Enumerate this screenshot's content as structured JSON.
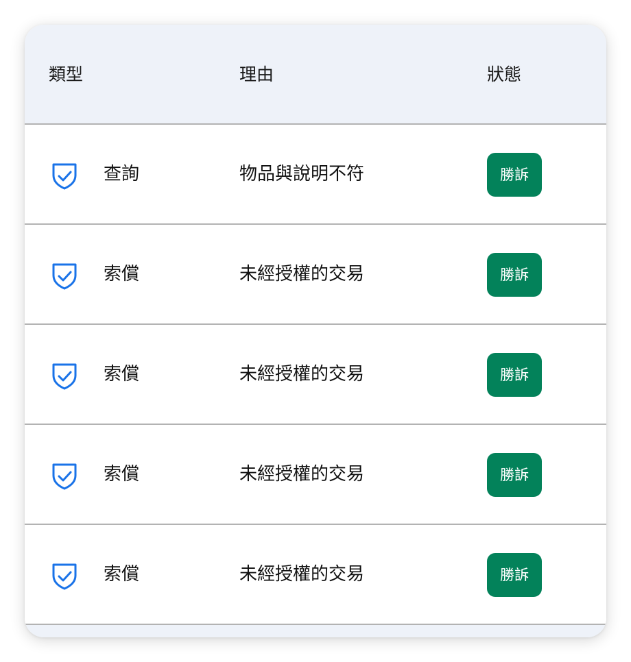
{
  "table": {
    "headers": {
      "type": "類型",
      "reason": "理由",
      "status": "狀態"
    },
    "rows": [
      {
        "icon": "shield-check-icon",
        "type": "查詢",
        "reason": "物品與說明不符",
        "status": "勝訴"
      },
      {
        "icon": "shield-check-icon",
        "type": "索償",
        "reason": "未經授權的交易",
        "status": "勝訴"
      },
      {
        "icon": "shield-check-icon",
        "type": "索償",
        "reason": "未經授權的交易",
        "status": "勝訴"
      },
      {
        "icon": "shield-check-icon",
        "type": "索償",
        "reason": "未經授權的交易",
        "status": "勝訴"
      },
      {
        "icon": "shield-check-icon",
        "type": "索償",
        "reason": "未經授權的交易",
        "status": "勝訴"
      }
    ]
  },
  "colors": {
    "header_bg": "#eef2f9",
    "icon_blue": "#1a73e8",
    "badge_green": "#03825a",
    "divider": "#b3b3b3"
  }
}
